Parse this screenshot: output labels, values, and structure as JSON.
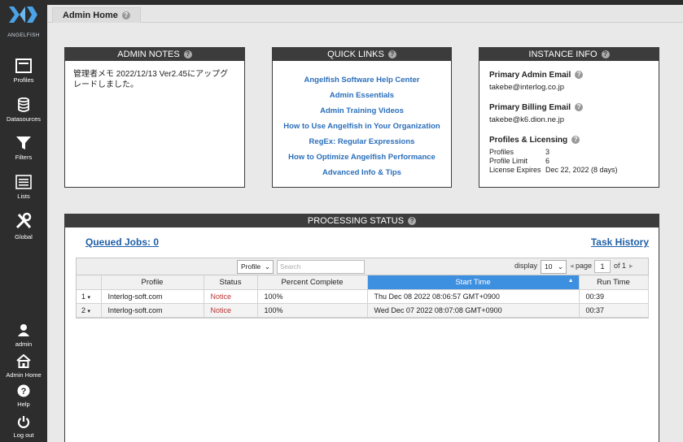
{
  "brand": {
    "logo_text": "ANGELFISH",
    "accent": "#2a6ebb"
  },
  "sidebar": {
    "items": [
      {
        "label": "Profiles",
        "icon": "profiles-icon"
      },
      {
        "label": "Datasources",
        "icon": "database-icon"
      },
      {
        "label": "Filters",
        "icon": "filter-icon"
      },
      {
        "label": "Lists",
        "icon": "list-icon"
      },
      {
        "label": "Global",
        "icon": "tools-icon"
      }
    ],
    "bottom": [
      {
        "label": "admin",
        "icon": "user-icon"
      },
      {
        "label": "Admin Home",
        "icon": "home-icon"
      },
      {
        "label": "Help",
        "icon": "help-icon"
      },
      {
        "label": "Log out",
        "icon": "power-icon"
      }
    ]
  },
  "header": {
    "title": "Admin Home"
  },
  "admin_notes": {
    "title": "ADMIN NOTES",
    "text": "管理者メモ 2022/12/13 Ver2.45にアップグレードしました。"
  },
  "quick_links": {
    "title": "QUICK LINKS",
    "links": [
      "Angelfish Software Help Center",
      "Admin Essentials",
      "Admin Training Videos",
      "How to Use Angelfish in Your Organization",
      "RegEx: Regular Expressions",
      "How to Optimize Angelfish Performance",
      "Advanced Info & Tips"
    ]
  },
  "instance_info": {
    "title": "INSTANCE INFO",
    "primary_admin_label": "Primary Admin Email",
    "primary_admin_value": "takebe@interlog.co.jp",
    "billing_label": "Primary Billing Email",
    "billing_value": "takebe@k6.dion.ne.jp",
    "licensing_label": "Profiles & Licensing",
    "profiles_key": "Profiles",
    "profiles_val": "3",
    "limit_key": "Profile Limit",
    "limit_val": "6",
    "expires_key": "License Expires",
    "expires_val": "Dec 22, 2022 (8 days)"
  },
  "processing": {
    "title": "PROCESSING STATUS",
    "queued": "Queued Jobs: 0",
    "task_history": "Task History",
    "toolbar": {
      "filter_select": "Profile",
      "search_placeholder": "Search",
      "display_label": "display",
      "display_value": "10",
      "page_label": "page",
      "page_value": "1",
      "of_label": "of 1"
    },
    "columns": [
      "Profile",
      "Status",
      "Percent Complete",
      "Start Time",
      "Run Time"
    ],
    "rows": [
      {
        "num": "1",
        "profile": "Interlog-soft.com",
        "status": "Notice",
        "percent": "100%",
        "start": "Thu Dec 08 2022 08:06:57 GMT+0900",
        "run": "00:39"
      },
      {
        "num": "2",
        "profile": "Interlog-soft.com",
        "status": "Notice",
        "percent": "100%",
        "start": "Wed Dec 07 2022 08:07:08 GMT+0900",
        "run": "00:37"
      }
    ]
  }
}
